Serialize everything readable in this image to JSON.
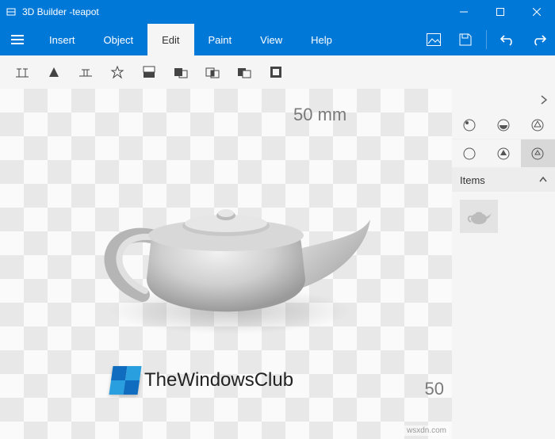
{
  "titlebar": {
    "app_name": "3D Builder",
    "document": "-teapot"
  },
  "menu": {
    "insert": "Insert",
    "object": "Object",
    "edit": "Edit",
    "paint": "Paint",
    "view": "View",
    "help": "Help"
  },
  "canvas": {
    "ruler_top": "50 mm",
    "ruler_right": "50"
  },
  "sidepanel": {
    "items_label": "Items"
  },
  "watermark": {
    "text": "TheWindowsClub"
  },
  "source_badge": "wsxdn.com"
}
